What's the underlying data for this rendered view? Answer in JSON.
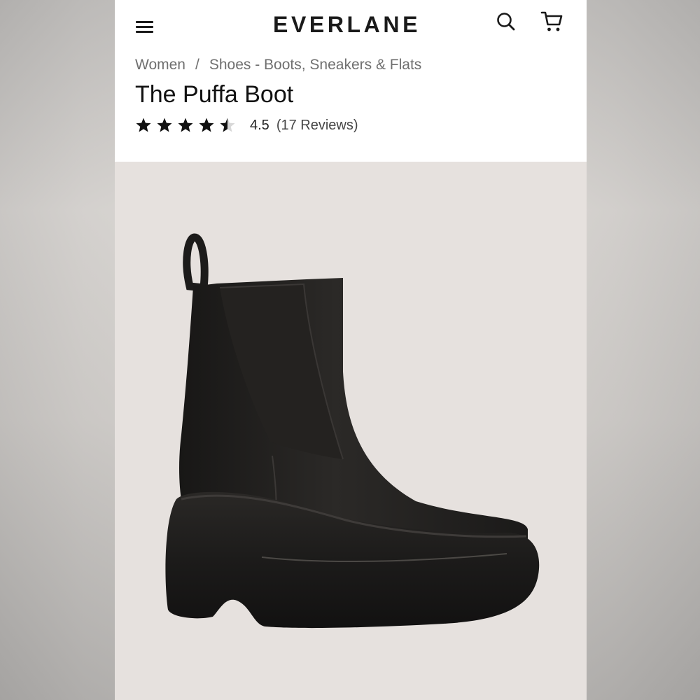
{
  "header": {
    "logo": "EVERLANE",
    "icons": {
      "menu": "hamburger-menu-icon",
      "search": "search-icon",
      "cart": "cart-icon"
    }
  },
  "breadcrumb": {
    "items": [
      "Women",
      "Shoes - Boots, Sneakers & Flats"
    ],
    "separator": "/"
  },
  "product": {
    "title": "The Puffa Boot",
    "rating": 4.5,
    "rating_label": "4.5",
    "reviews_label": "(17 Reviews)",
    "stars_max": 5
  },
  "colors": {
    "text": "#111111",
    "muted": "#6f6f6f",
    "image_bg": "#e6e1de",
    "boot": "#1f1d1c"
  }
}
